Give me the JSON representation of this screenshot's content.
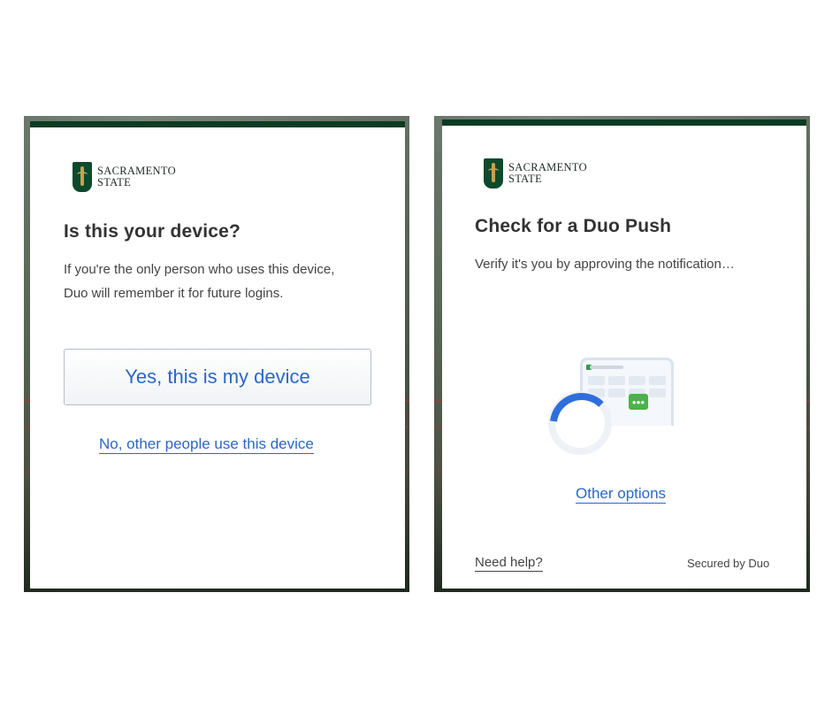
{
  "left": {
    "logo": {
      "line1": "SACRAMENTO",
      "line2": "STATE"
    },
    "title": "Is this your device?",
    "description_line1": "If you're the only person who uses this device,",
    "description_line2": "Duo will remember it for future logins.",
    "primary_button": "Yes, this is my device",
    "secondary_link": "No, other people use this device"
  },
  "right": {
    "logo": {
      "line1": "SACRAMENTO",
      "line2": "STATE"
    },
    "title": "Check for a Duo Push",
    "description": "Verify it's you by approving the notification…",
    "illustration_icons": [
      "phone-icon",
      "loading-spinner-icon"
    ],
    "other_options_link": "Other options",
    "help_link": "Need help?",
    "secured_by": "Secured by Duo"
  },
  "colors": {
    "brand_green": "#0b3b24",
    "link_blue": "#2b67c8",
    "spinner_blue": "#2f6fdc",
    "duo_green": "#49b349"
  }
}
